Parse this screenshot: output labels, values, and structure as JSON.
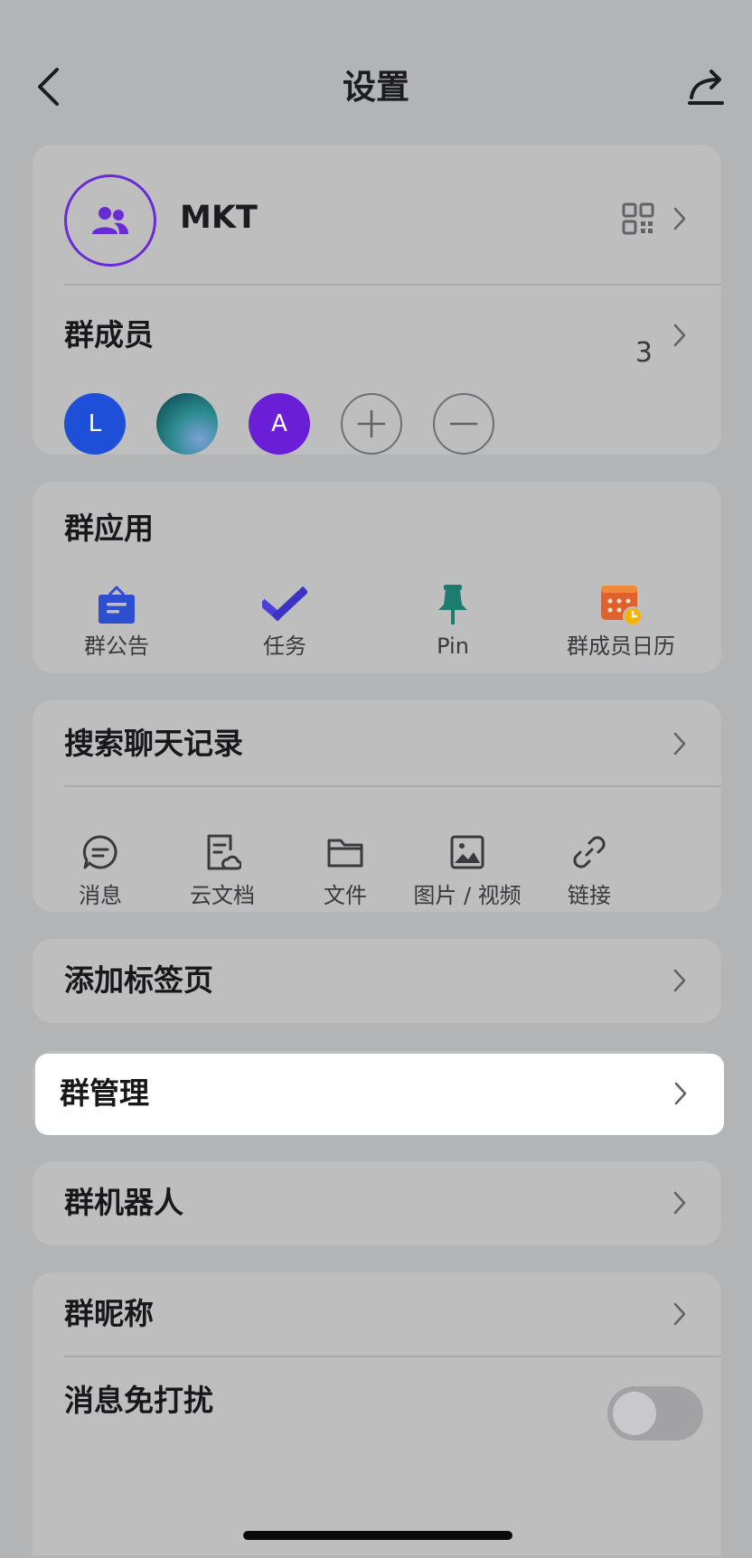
{
  "nav": {
    "title": "设置",
    "back_icon": "chevron-left-icon",
    "share_icon": "share-icon"
  },
  "group": {
    "name": "MKT",
    "avatar_icon": "group-people-icon",
    "qr_icon": "qr-code-icon",
    "members_label": "群成员",
    "member_count": "3",
    "members": [
      {
        "initial": "L",
        "color": "#1e4fd8"
      },
      {
        "initial": "",
        "color": "#2a8a8e"
      },
      {
        "initial": "A",
        "color": "#6a1fd6"
      }
    ],
    "add_member_icon": "plus-circle-icon",
    "remove_member_icon": "minus-circle-icon"
  },
  "apps": {
    "title": "群应用",
    "items": [
      {
        "label": "群公告",
        "icon": "announcement-icon",
        "color": "#2d4ecf"
      },
      {
        "label": "任务",
        "icon": "task-check-icon",
        "color": "#4b41d6"
      },
      {
        "label": "Pin",
        "icon": "pin-icon",
        "color": "#1c7d6e"
      },
      {
        "label": "群成员日历",
        "icon": "calendar-icon",
        "color": "#e0612a"
      }
    ]
  },
  "search": {
    "title": "搜索聊天记录",
    "items": [
      {
        "label": "消息",
        "icon": "message-icon"
      },
      {
        "label": "云文档",
        "icon": "cloud-doc-icon"
      },
      {
        "label": "文件",
        "icon": "folder-icon"
      },
      {
        "label": "图片 / 视频",
        "icon": "image-icon"
      },
      {
        "label": "链接",
        "icon": "link-icon"
      }
    ]
  },
  "rows": {
    "add_tab": "添加标签页",
    "group_manage": "群管理",
    "group_bot": "群机器人",
    "group_nickname": "群昵称",
    "mute": "消息免打扰"
  },
  "mute_toggle_on": false
}
